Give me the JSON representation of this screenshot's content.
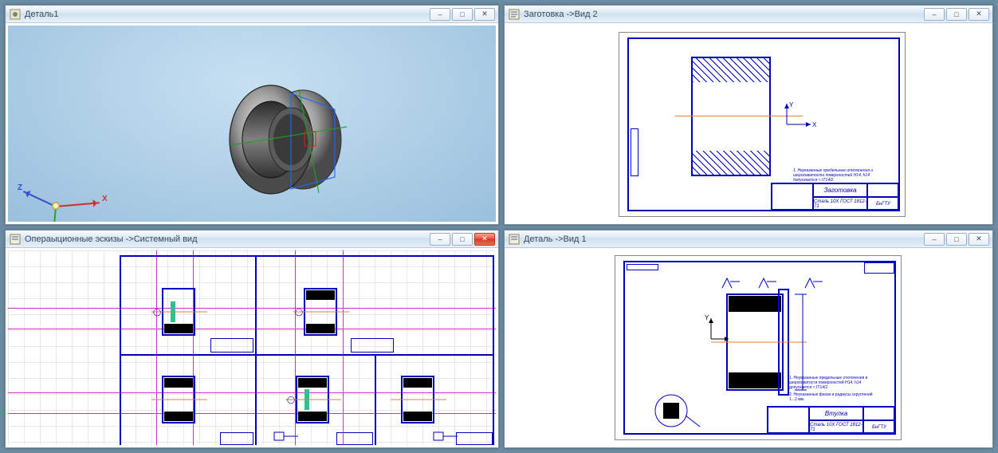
{
  "windows": {
    "w1": {
      "title": "Деталь1"
    },
    "w2": {
      "title": "Заготовка  ->Вид 2"
    },
    "w3": {
      "title": "Операыционные эскизы ->Системный вид"
    },
    "w4": {
      "title": "Деталь ->Вид 1"
    }
  },
  "axis": {
    "x": "X",
    "y": "Y",
    "z": "Z"
  },
  "drawing_axis": {
    "x": "X",
    "y": "Y"
  },
  "stamp": {
    "title_zagotovka": "Заготовка",
    "title_detal": "Втулка",
    "org": "БнГТУ",
    "material": "Сталь 10Х ГОСТ 1812-71",
    "note1": "1. Неуказанные предельные отклонения и шероховатости поверхностей H14, h14 допускается ≈ IT14/2.",
    "note2": "2. Неуказанные фаски и радиусы скруглений 1...2 мм."
  },
  "icons": {
    "min": "–",
    "max": "□",
    "close": "✕"
  }
}
